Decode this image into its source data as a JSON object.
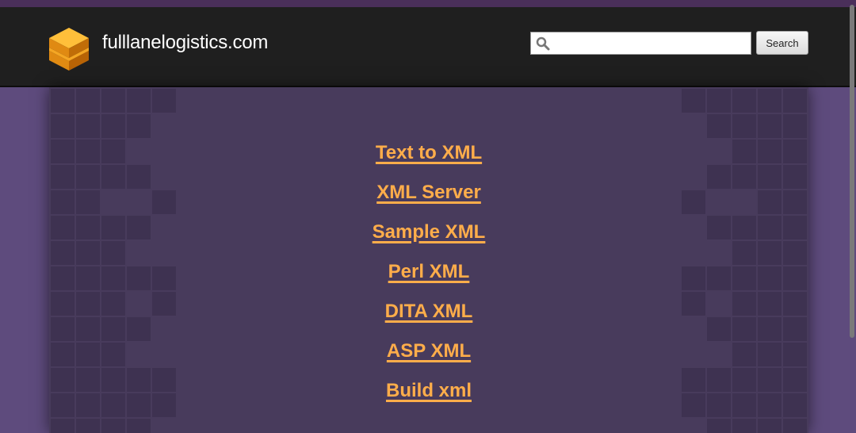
{
  "header": {
    "site_name": "fulllanelogistics.com",
    "logo_icon": "stacked-layers-icon",
    "search": {
      "placeholder": "",
      "value": "",
      "button_label": "Search"
    }
  },
  "links": [
    {
      "label": "Text to XML"
    },
    {
      "label": "XML Server"
    },
    {
      "label": "Sample XML"
    },
    {
      "label": "Perl XML"
    },
    {
      "label": "DITA XML"
    },
    {
      "label": "ASP XML"
    },
    {
      "label": "Build xml"
    }
  ],
  "colors": {
    "background": "#5e4b7d",
    "header": "#1f1f1f",
    "content": "#483b5c",
    "link": "#ffad4a"
  }
}
